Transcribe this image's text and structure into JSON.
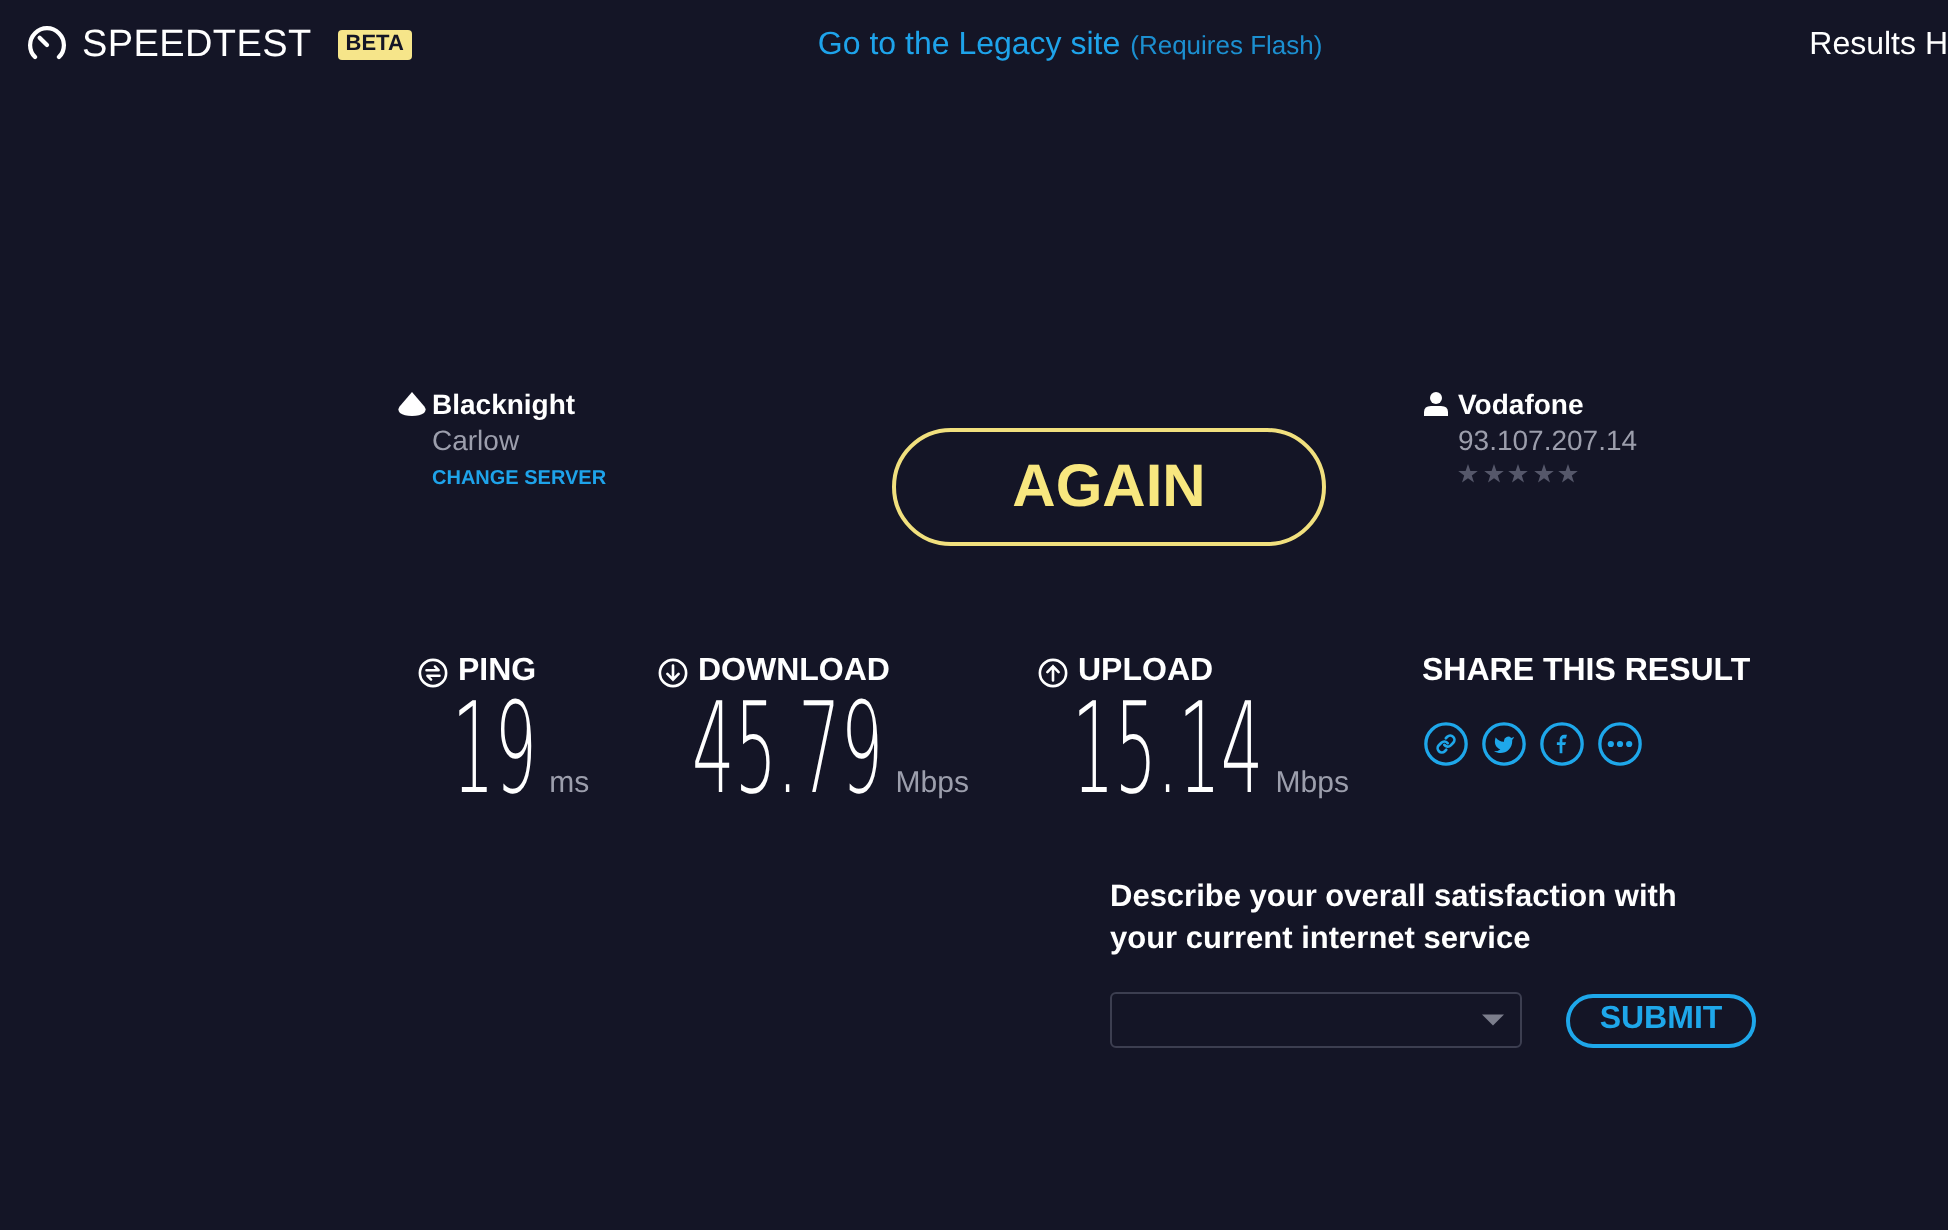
{
  "header": {
    "logo_text": "SPEEDTEST",
    "badge": "BETA",
    "legacy_link": "Go to the Legacy site",
    "legacy_note": "(Requires Flash)",
    "results_link": "Results H"
  },
  "server": {
    "name": "Blacknight",
    "location": "Carlow",
    "action": "CHANGE SERVER"
  },
  "again_button": "AGAIN",
  "provider": {
    "name": "Vodafone",
    "ip": "93.107.207.14",
    "stars": 0
  },
  "metrics": [
    {
      "kind": "ping",
      "label": "PING",
      "value": "19",
      "unit": "ms"
    },
    {
      "kind": "download",
      "label": "DOWNLOAD",
      "value": "45.79",
      "unit": "Mbps"
    },
    {
      "kind": "upload",
      "label": "UPLOAD",
      "value": "15.14",
      "unit": "Mbps"
    }
  ],
  "share": {
    "title": "SHARE THIS RESULT",
    "buttons": [
      {
        "kind": "link"
      },
      {
        "kind": "bird"
      },
      {
        "kind": "facebook"
      },
      {
        "kind": "more"
      }
    ]
  },
  "survey": {
    "question": "Describe your overall satisfaction with your current internet service",
    "submit": "SUBMIT"
  }
}
